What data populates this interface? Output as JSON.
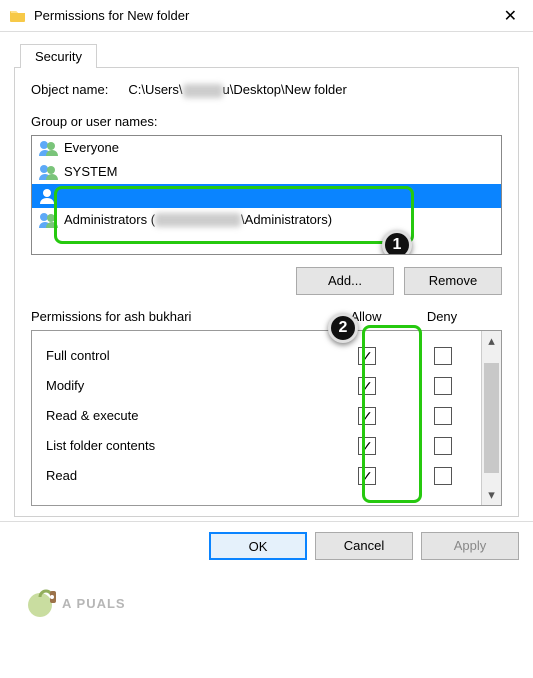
{
  "window": {
    "title": "Permissions for New folder"
  },
  "tabs": {
    "security": "Security"
  },
  "object": {
    "label": "Object name:",
    "path_prefix": "C:\\Users\\",
    "path_suffix": "u\\Desktop\\New folder"
  },
  "groups": {
    "label": "Group or user names:",
    "items": [
      "Everyone",
      "SYSTEM",
      "",
      "Administrators ("
    ],
    "admins_mid_blur": true,
    "admins_suffix": "\\Administrators)"
  },
  "buttons": {
    "add": "Add...",
    "remove": "Remove",
    "ok": "OK",
    "cancel": "Cancel",
    "apply": "Apply"
  },
  "perms": {
    "header_prefix": "Permissions for ",
    "user": "ash bukhari",
    "col_allow": "Allow",
    "col_deny": "Deny",
    "rows": [
      {
        "name": "Full control",
        "allow": true,
        "deny": false
      },
      {
        "name": "Modify",
        "allow": true,
        "deny": false
      },
      {
        "name": "Read & execute",
        "allow": true,
        "deny": false
      },
      {
        "name": "List folder contents",
        "allow": true,
        "deny": false
      },
      {
        "name": "Read",
        "allow": true,
        "deny": false
      }
    ]
  },
  "annotations": {
    "badge1": "1",
    "badge2": "2"
  },
  "branding": {
    "text": "A  PUALS"
  }
}
